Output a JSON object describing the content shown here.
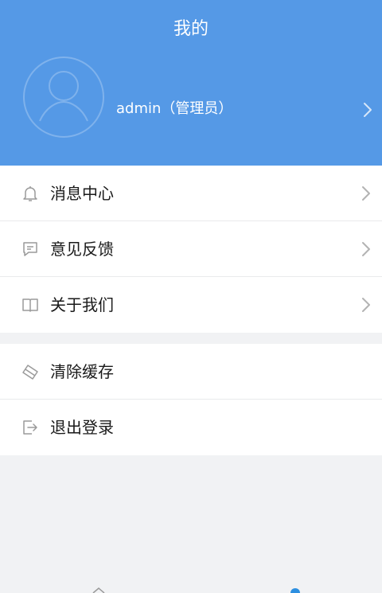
{
  "header": {
    "title": "我的",
    "background_color": "#5599e6"
  },
  "profile": {
    "avatar_icon": "user-avatar-icon",
    "name": "admin（管理员）",
    "chevron_icon": "chevron-right-icon"
  },
  "menu_group_1": [
    {
      "label": "消息中心",
      "icon": "bell-icon",
      "has_chevron": true
    },
    {
      "label": "意见反馈",
      "icon": "message-icon",
      "has_chevron": true
    },
    {
      "label": "关于我们",
      "icon": "book-icon",
      "has_chevron": true
    }
  ],
  "menu_group_2": [
    {
      "label": "清除缓存",
      "icon": "eraser-icon",
      "has_chevron": false
    },
    {
      "label": "退出登录",
      "icon": "logout-icon",
      "has_chevron": false
    }
  ],
  "tab_bar": {
    "icons": [
      "home-icon",
      "profile-icon"
    ],
    "active_color": "#2d8fe0"
  }
}
